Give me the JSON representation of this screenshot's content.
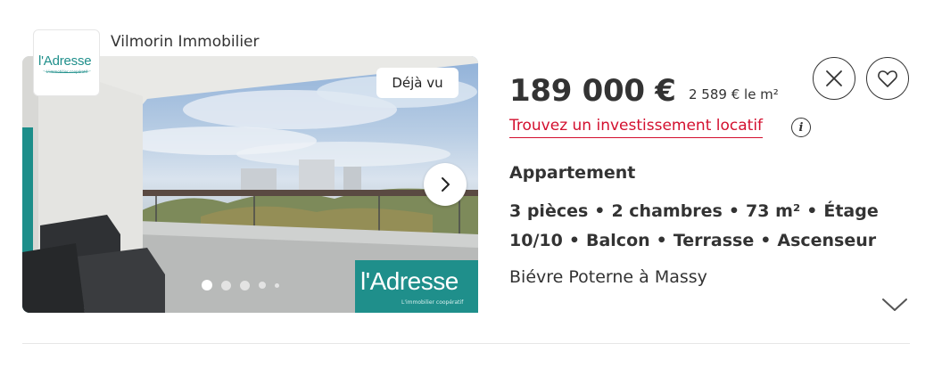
{
  "agency": {
    "name": "Vilmorin Immobilier",
    "logo_text": "l'Adresse",
    "logo_tagline": "L'immobilier coopératif"
  },
  "photo": {
    "seen_badge": "Déjà vu",
    "watermark_text": "l'Adresse",
    "watermark_tagline": "L'immobilier coopératif",
    "carousel_dots": 5,
    "active_dot": 0
  },
  "listing": {
    "price": "189 000 €",
    "price_per_sqm": "2 589 € le m²",
    "invest_link": "Trouvez un investissement locatif",
    "property_type": "Appartement",
    "features": [
      "3 pièces",
      "2 chambres",
      "73 m²",
      "Étage 10/10",
      "Balcon",
      "Terrasse",
      "Ascenseur"
    ],
    "location": "Biévre Poterne à Massy"
  },
  "colors": {
    "accent_red": "#d3102f",
    "brand_teal": "#1f8f8b",
    "text": "#333333",
    "divider": "#e6e6e6"
  },
  "icons": [
    "chevron-right-icon",
    "close-icon",
    "heart-icon",
    "info-icon",
    "chevron-down-icon"
  ]
}
